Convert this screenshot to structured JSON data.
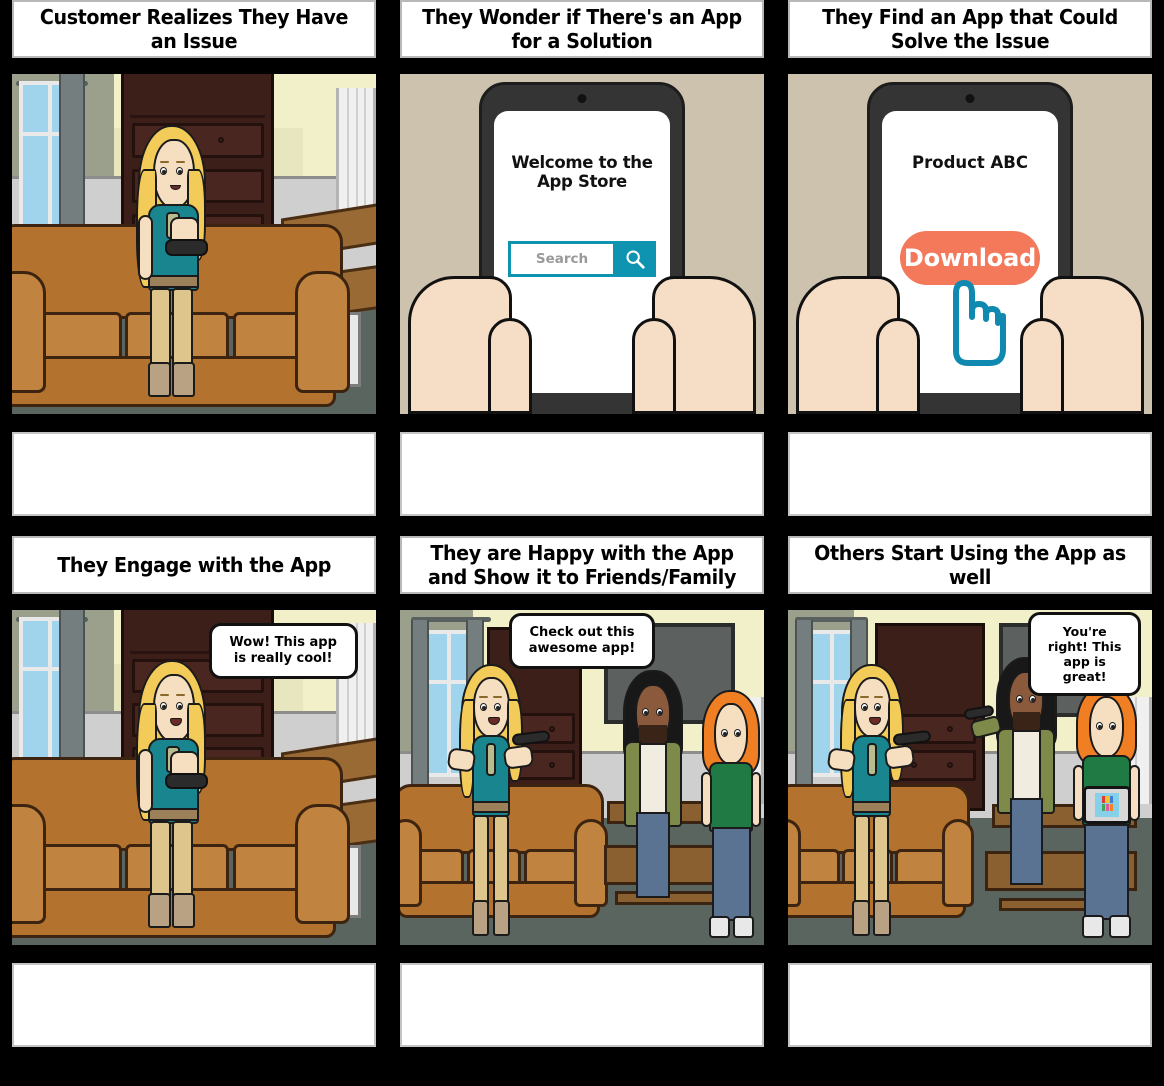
{
  "storyboard": {
    "cells": [
      {
        "id": "cell-1",
        "title": "Customer Realizes They Have an Issue",
        "scene": "living-room-girl-sitting-sofa",
        "speech": null,
        "caption": ""
      },
      {
        "id": "cell-2",
        "title": "They Wonder if There's an App for a Solution",
        "scene": "hands-holding-phone-app-store",
        "phone": {
          "screen_title": "Welcome to the App Store",
          "search_placeholder": "Search",
          "search_value": "",
          "search_icon": "magnifier-icon",
          "accent": "#0e93b0"
        },
        "caption": ""
      },
      {
        "id": "cell-3",
        "title": "They Find an App that Could Solve the Issue",
        "scene": "hands-holding-phone-product-page",
        "phone": {
          "screen_title": "Product ABC",
          "download_label": "Download",
          "button_color": "#f4795b",
          "cursor_icon": "pointing-hand-cursor-icon",
          "cursor_color": "#1089b0"
        },
        "caption": ""
      },
      {
        "id": "cell-4",
        "title": "They Engage with the App",
        "scene": "living-room-girl-sitting-sofa-happy",
        "speech": "Wow! This app is really cool!",
        "caption": ""
      },
      {
        "id": "cell-5",
        "title": "They are Happy with the App and Show it to Friends/Family",
        "scene": "living-room-three-people",
        "speech": "Check out this awesome app!",
        "caption": ""
      },
      {
        "id": "cell-6",
        "title": "Others Start Using the App as well",
        "scene": "living-room-three-people-tablet",
        "speech": "You're right! This app is great!",
        "caption": ""
      }
    ]
  },
  "palette": {
    "background": "#000000",
    "panel_bg": "#ffffff",
    "scene_wall": "#f2f0c8",
    "scene_floor": "#5b6560",
    "couch": "#b3732e",
    "cabinet": "#3d1f1a",
    "phone_bg": "#cdc2ae",
    "teal_shirt": "#18858f",
    "skin": "#f5dfc0",
    "hair_blonde": "#f2cb58",
    "hair_orange": "#f07e22",
    "green_shirt": "#1f7a44",
    "olive_jacket": "#7d8a49",
    "jeans": "#5a7392"
  }
}
